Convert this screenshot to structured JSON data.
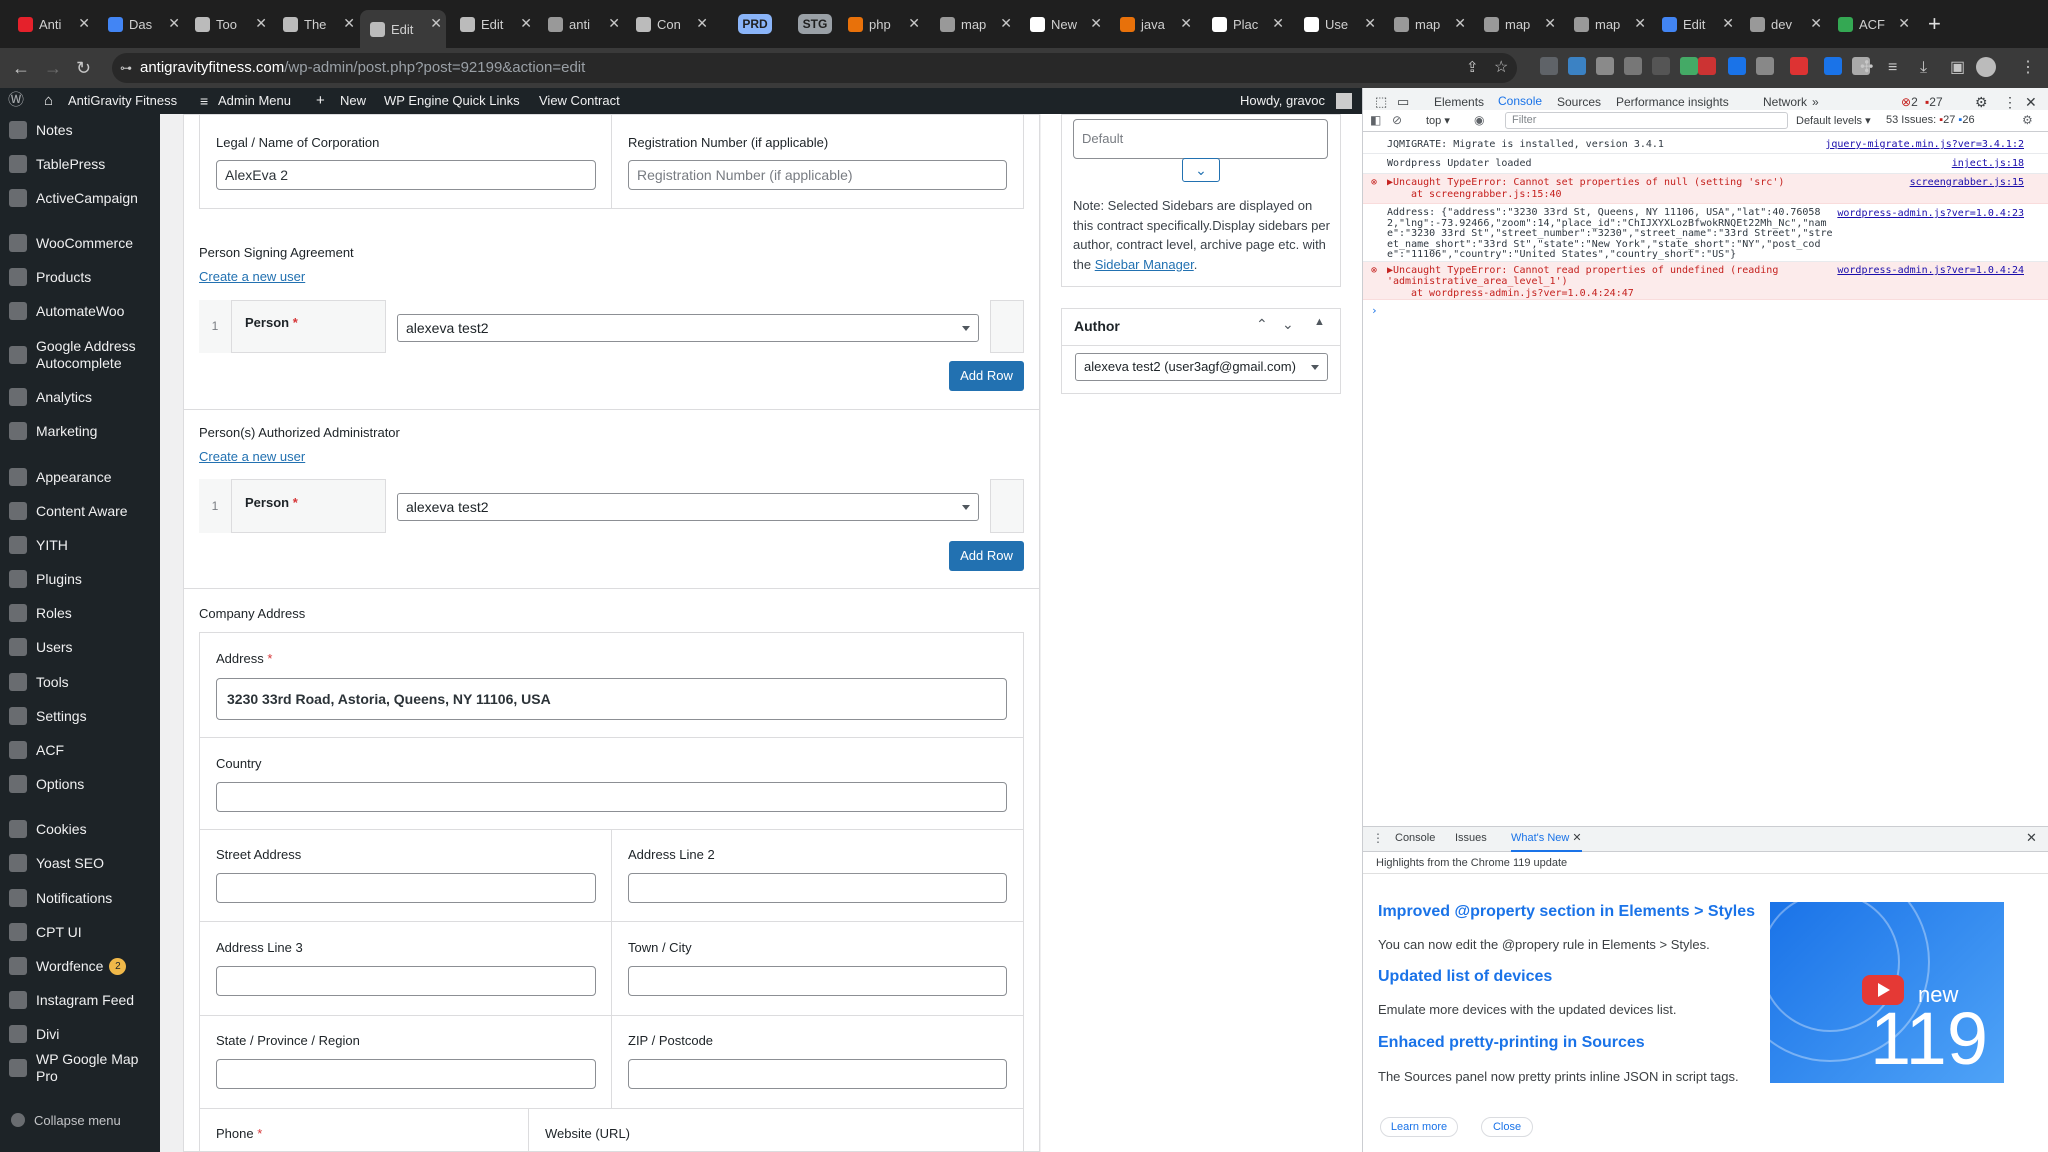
{
  "browser": {
    "tabs": [
      {
        "label": "Anti",
        "color": "#e5212b"
      },
      {
        "label": "Das",
        "color": "#4285f4"
      },
      {
        "label": "Too",
        "color": "#bbbbbb"
      },
      {
        "label": "The",
        "color": "#bbbbbb"
      },
      {
        "label": "Edit",
        "color": "#bbbbbb"
      },
      {
        "label": "Edit",
        "color": "#bbbbbb"
      },
      {
        "label": "anti",
        "color": "#999999"
      },
      {
        "label": "Con",
        "color": "#bbbbbb"
      },
      {
        "label": "php",
        "color": "#e8710a"
      },
      {
        "label": "map",
        "color": "#999999"
      },
      {
        "label": "New",
        "color": "#ffffff"
      },
      {
        "label": "java",
        "color": "#e8710a"
      },
      {
        "label": "Plac",
        "color": "#ffffff"
      },
      {
        "label": "Use",
        "color": "#ffffff"
      },
      {
        "label": "map",
        "color": "#999999"
      },
      {
        "label": "map",
        "color": "#999999"
      },
      {
        "label": "map",
        "color": "#999999"
      },
      {
        "label": "Edit",
        "color": "#4285f4"
      },
      {
        "label": "dev",
        "color": "#999999"
      },
      {
        "label": "ACF",
        "color": "#34a853"
      }
    ],
    "pill_prd": "PRD",
    "pill_stg": "STG",
    "new_tab": "+",
    "url_domain": "antigravityfitness.com",
    "url_path": "/wp-admin/post.php?post=92199&action=edit"
  },
  "wp_adminbar": {
    "site_name": "AntiGravity Fitness",
    "admin_menu": "Admin Menu",
    "new": "New",
    "wpengine": "WP Engine Quick Links",
    "view_contract": "View Contract",
    "howdy": "Howdy, gravoc"
  },
  "sidebar": [
    {
      "label": "Notes",
      "top": 0
    },
    {
      "label": "TablePress"
    },
    {
      "label": "ActiveCampaign"
    },
    {
      "label": "WooCommerce"
    },
    {
      "label": "Products"
    },
    {
      "label": "AutomateWoo"
    },
    {
      "label": "Google Address Autocomplete"
    },
    {
      "label": "Analytics"
    },
    {
      "label": "Marketing"
    },
    {
      "label": "Appearance"
    },
    {
      "label": "Content Aware"
    },
    {
      "label": "YITH"
    },
    {
      "label": "Plugins"
    },
    {
      "label": "Roles"
    },
    {
      "label": "Users"
    },
    {
      "label": "Tools"
    },
    {
      "label": "Settings"
    },
    {
      "label": "ACF"
    },
    {
      "label": "Options"
    },
    {
      "label": "Cookies"
    },
    {
      "label": "Yoast SEO"
    },
    {
      "label": "Notifications"
    },
    {
      "label": "CPT UI"
    },
    {
      "label": "Wordfence",
      "badge": "2"
    },
    {
      "label": "Instagram Feed"
    },
    {
      "label": "Divi"
    },
    {
      "label": "WP Google Map Pro"
    },
    {
      "label": "Collapse menu"
    }
  ],
  "form": {
    "legal_label": "Legal / Name of Corporation",
    "legal_value": "AlexEva 2",
    "reg_label": "Registration Number (if applicable)",
    "reg_placeholder": "Registration Number (if applicable)",
    "signing_title": "Person Signing Agreement",
    "create_user": "Create a new user",
    "row_num": "1",
    "person_label": "Person",
    "req": "*",
    "signing_person": "alexeva test2",
    "add_row": "Add Row",
    "admin_title": "Person(s) Authorized Administrator",
    "admin_person": "alexeva test2",
    "company_address": "Company Address",
    "address_label": "Address",
    "address_value": "3230 33rd Road, Astoria, Queens, NY 11106, USA",
    "country_label": "Country",
    "street_label": "Street Address",
    "line2_label": "Address Line 2",
    "line3_label": "Address Line 3",
    "town_label": "Town / City",
    "state_label": "State / Province / Region",
    "zip_label": "ZIP / Postcode",
    "phone_label": "Phone",
    "website_label": "Website (URL)"
  },
  "right_panel": {
    "default_select": "Default",
    "note": "Note: Selected Sidebars are displayed on this contract specifically.Display sidebars per author, contract level, archive page etc. with the",
    "sidebar_manager": "Sidebar Manager",
    "note_end": ".",
    "author_title": "Author",
    "author_value": "alexeva test2 (user3agf@gmail.com)"
  },
  "devtools": {
    "tabs": [
      "Elements",
      "Console",
      "Sources",
      "Performance insights",
      "Network"
    ],
    "err_count": "2",
    "warn_count": "27",
    "context": "top",
    "filter_placeholder": "Filter",
    "levels": "Default levels",
    "issues": "53 Issues:",
    "issues_err": "27",
    "issues_info": "26",
    "messages": [
      {
        "text": "JQMIGRATE: Migrate is installed, version 3.4.1",
        "src": "jquery-migrate.min.js?ver=3.4.1:2"
      },
      {
        "text": "Wordpress Updater loaded",
        "src": "inject.js:18"
      },
      {
        "text": "▶Uncaught TypeError: Cannot set properties of null (setting 'src')",
        "sub": "at screengrabber.js:15:40",
        "src": "screengrabber.js:15",
        "err": true
      },
      {
        "text": "Address: {\"address\":\"3230 33rd St, Queens, NY 11106, USA\",\"lat\":40.760582,\"lng\":-73.92466,\"zoom\":14,\"place_id\":\"ChIJXYXLozBfwokRNQEt22Mh_Nc\",\"name\":\"3230 33rd St\",\"street_number\":\"3230\",\"street_name\":\"33rd Street\",\"street_name_short\":\"33rd St\",\"state\":\"New York\",\"state_short\":\"NY\",\"post_code\":\"11106\",\"country\":\"United States\",\"country_short\":\"US\"}",
        "src": "wordpress-admin.js?ver=1.0.4:23"
      },
      {
        "text": "▶Uncaught TypeError: Cannot read properties of undefined (reading 'administrative_area_level_1')",
        "sub": "at wordpress-admin.js?ver=1.0.4:24:47",
        "src": "wordpress-admin.js?ver=1.0.4:24",
        "err": true
      }
    ],
    "drawer_tabs": [
      "Console",
      "Issues",
      "What's New"
    ],
    "whats_new_sub": "Highlights from the Chrome 119 update",
    "items": [
      {
        "title": "Improved @property section in Elements > Styles",
        "body": "You can now edit the @propery rule in Elements > Styles."
      },
      {
        "title": "Updated list of devices",
        "body": "Emulate more devices with the updated devices list."
      },
      {
        "title": "Enhaced pretty-printing in Sources",
        "body": "The Sources panel now pretty prints inline JSON in script tags."
      }
    ],
    "promo_new": "new",
    "promo_num": "119",
    "learn_more": "Learn more",
    "close": "Close"
  }
}
